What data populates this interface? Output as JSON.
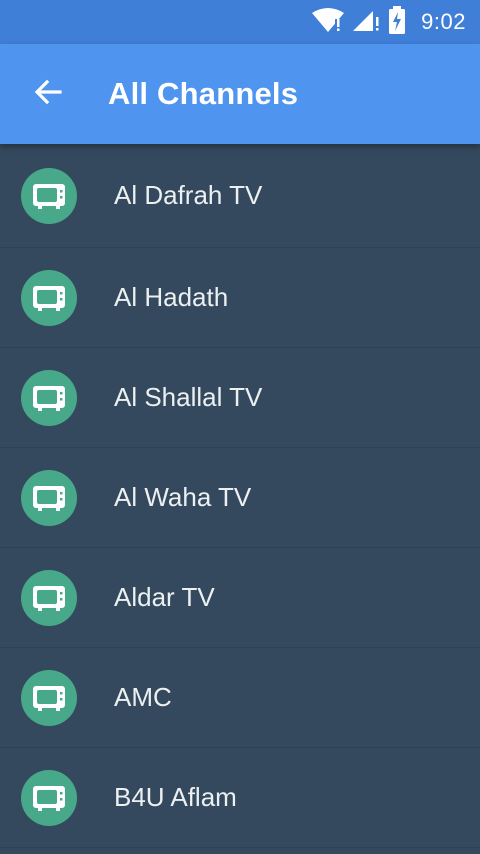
{
  "status_bar": {
    "time": "9:02",
    "icons": [
      "wifi-icon",
      "signal-icon",
      "battery-charging-icon"
    ]
  },
  "app_bar": {
    "back_icon": "arrow-left-icon",
    "title": "All Channels"
  },
  "channels": [
    {
      "name": "Al Dafrah TV",
      "icon": "tv-icon"
    },
    {
      "name": "Al Hadath",
      "icon": "tv-icon"
    },
    {
      "name": "Al Shallal TV",
      "icon": "tv-icon"
    },
    {
      "name": "Al Waha TV",
      "icon": "tv-icon"
    },
    {
      "name": "Aldar TV",
      "icon": "tv-icon"
    },
    {
      "name": "AMC",
      "icon": "tv-icon"
    },
    {
      "name": "B4U Aflam",
      "icon": "tv-icon"
    }
  ],
  "colors": {
    "status_bar": "#3f7fd8",
    "app_bar": "#4f95f0",
    "list_background": "#34495e",
    "divider": "#2e4155",
    "avatar": "#48a88a",
    "text": "#ecf0f1"
  }
}
